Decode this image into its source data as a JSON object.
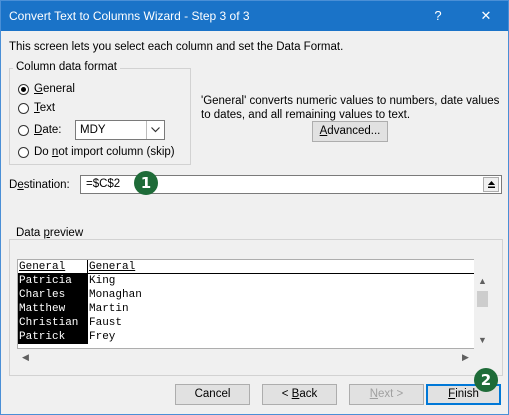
{
  "window": {
    "title": "Convert Text to Columns Wizard - Step 3 of 3",
    "help": "?",
    "close": "✕"
  },
  "intro": "This screen lets you select each column and set the Data Format.",
  "format_group": {
    "legend": "Column data format",
    "options": [
      {
        "label": "General",
        "checked": true
      },
      {
        "label": "Text",
        "checked": false
      },
      {
        "label": "Date:",
        "checked": false
      },
      {
        "label": "Do not import column (skip)",
        "checked": false
      }
    ],
    "date_value": "MDY"
  },
  "description": "'General' converts numeric values to numbers, date values to dates, and all remaining values to text.",
  "advanced_button": "Advanced...",
  "destination": {
    "label": "Destination:",
    "value": "=$C$2"
  },
  "badges": [
    "1",
    "2"
  ],
  "preview": {
    "legend": "Data preview",
    "columns": [
      {
        "header": "General",
        "cells": [
          "Patricia",
          "Charles",
          "Matthew",
          "Christian",
          "Patrick"
        ]
      },
      {
        "header": "General",
        "cells": [
          "King",
          "Monaghan",
          "Martin",
          "Faust",
          "Frey"
        ]
      }
    ]
  },
  "buttons": {
    "cancel": "Cancel",
    "back": "< Back",
    "next": "Next >",
    "finish": "Finish"
  },
  "colors": {
    "titlebar": "#1a73c8",
    "badge": "#1e6b38",
    "default_button_border": "#0078d7"
  }
}
